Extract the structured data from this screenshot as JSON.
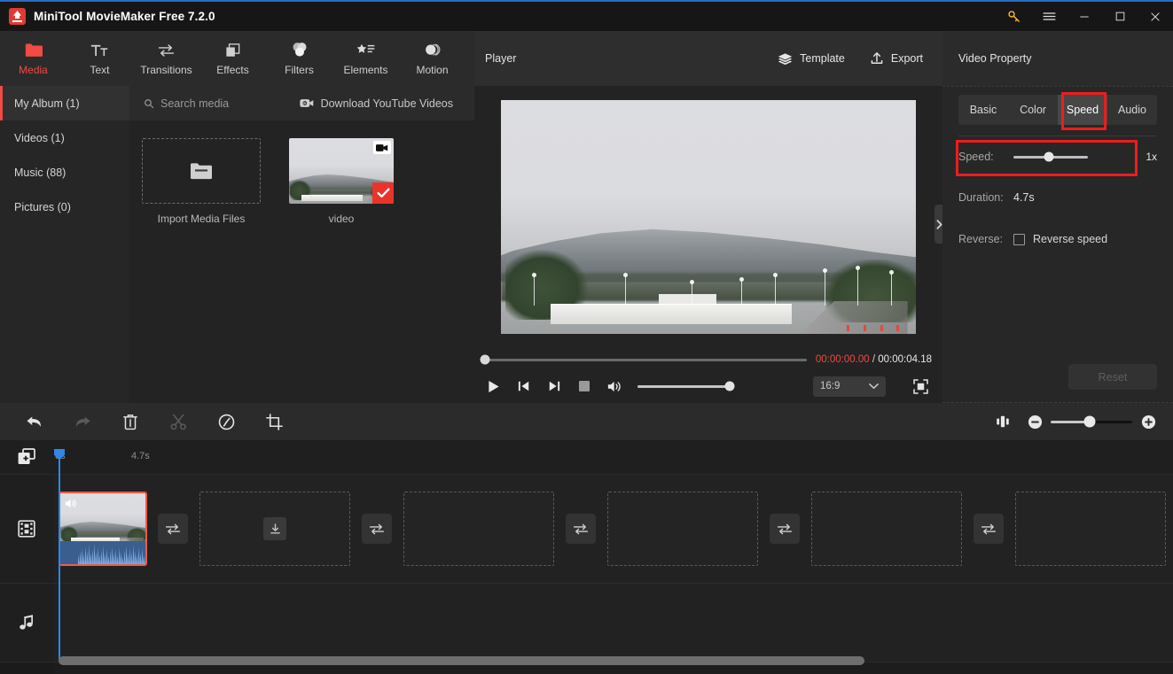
{
  "window": {
    "title": "MiniTool MovieMaker Free 7.2.0",
    "controls": {
      "key": "key-icon",
      "menu": "hamburger-menu-icon",
      "minimize": "minimize-icon",
      "maximize": "maximize-icon",
      "close": "close-icon"
    }
  },
  "toolbar": {
    "items": [
      {
        "label": "Media",
        "icon": "folder-icon",
        "active": true
      },
      {
        "label": "Text",
        "icon": "text-icon",
        "active": false
      },
      {
        "label": "Transitions",
        "icon": "transitions-icon",
        "active": false
      },
      {
        "label": "Effects",
        "icon": "effects-icon",
        "active": false
      },
      {
        "label": "Filters",
        "icon": "filters-icon",
        "active": false
      },
      {
        "label": "Elements",
        "icon": "elements-icon",
        "active": false
      },
      {
        "label": "Motion",
        "icon": "motion-icon",
        "active": false
      }
    ]
  },
  "media": {
    "albums": [
      {
        "label": "My Album (1)",
        "active": true
      },
      {
        "label": "Videos (1)",
        "active": false
      },
      {
        "label": "Music (88)",
        "active": false
      },
      {
        "label": "Pictures (0)",
        "active": false
      }
    ],
    "search_placeholder": "Search media",
    "download_label": "Download YouTube Videos",
    "import_label": "Import Media Files",
    "items": [
      {
        "label": "video",
        "selected": true,
        "type": "video"
      }
    ]
  },
  "player": {
    "title": "Player",
    "template_label": "Template",
    "export_label": "Export",
    "current_time": "00:00:00.00",
    "separator": "/",
    "total_time": "00:00:04.18",
    "aspect_ratio": "16:9",
    "seek_position_pct": 0,
    "volume_pct": 100
  },
  "property": {
    "title": "Video Property",
    "tabs": [
      {
        "label": "Basic",
        "active": false
      },
      {
        "label": "Color",
        "active": false
      },
      {
        "label": "Speed",
        "active": true
      },
      {
        "label": "Audio",
        "active": false
      }
    ],
    "speed_label": "Speed:",
    "speed_value": "1x",
    "speed_slider_pct": 48,
    "duration_label": "Duration:",
    "duration_value": "4.7s",
    "reverse_label": "Reverse:",
    "reverse_checkbox_label": "Reverse speed",
    "reverse_checked": false,
    "reset_label": "Reset",
    "highlight_color": "#ef1c1c"
  },
  "timeline": {
    "tools": [
      {
        "name": "undo-button",
        "icon": "undo-icon",
        "disabled": false
      },
      {
        "name": "redo-button",
        "icon": "redo-icon",
        "disabled": true
      },
      {
        "name": "delete-button",
        "icon": "trash-icon",
        "disabled": false
      },
      {
        "name": "split-button",
        "icon": "scissors-icon",
        "disabled": true
      },
      {
        "name": "speed-button",
        "icon": "speed-gauge-icon",
        "disabled": false
      },
      {
        "name": "crop-button",
        "icon": "crop-icon",
        "disabled": false
      }
    ],
    "zoom_pct": 48,
    "ruler_ticks": [
      "0s",
      "4.7s"
    ],
    "clip": {
      "selected": true,
      "has_audio": true
    },
    "placeholder_count": 5,
    "transition_count": 5
  }
}
